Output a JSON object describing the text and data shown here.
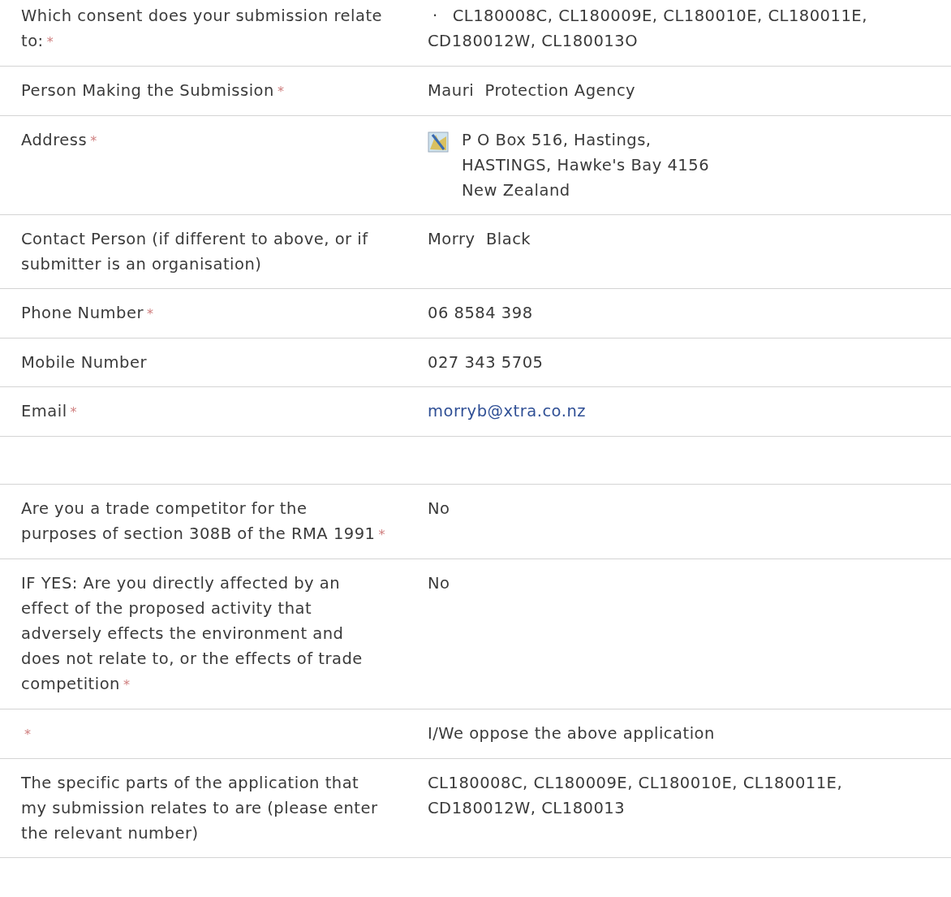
{
  "rows": [
    {
      "kind": "bullet",
      "label": "Which consent does your submission relate to:",
      "required_mark": "*",
      "bullet": "·",
      "value": "CL180008C, CL180009E, CL180010E, CL180011E, CD180012W, CL180013O"
    },
    {
      "kind": "text",
      "label": "Person Making the Submission",
      "required_mark": "*",
      "value": "Mauri  Protection Agency"
    },
    {
      "kind": "address",
      "label": "Address",
      "required_mark": "*",
      "lines": [
        "P O Box 516, Hastings,",
        "HASTINGS, Hawke's Bay 4156",
        "New Zealand"
      ]
    },
    {
      "kind": "text",
      "label": "Contact Person (if different to above, or if submitter is an organisation)",
      "value": "Morry  Black"
    },
    {
      "kind": "text",
      "label": "Phone Number",
      "required_mark": "*",
      "value": "06 8584 398"
    },
    {
      "kind": "text",
      "label": "Mobile Number",
      "value": "027 343 5705"
    },
    {
      "kind": "link",
      "label": "Email",
      "required_mark": "*",
      "value": "morryb@xtra.co.nz"
    },
    {
      "kind": "blank"
    },
    {
      "kind": "text",
      "label": "Are you a trade competitor for the purposes of section 308B of the RMA 1991",
      "required_mark": "*",
      "value": "No"
    },
    {
      "kind": "text",
      "label": "IF YES: Are you directly affected by an effect of the proposed activity that adversely effects the environment and does not relate to, or the effects of trade competition",
      "required_mark": "*",
      "value": "No"
    },
    {
      "kind": "text",
      "required_mark": "*",
      "value": "I/We oppose the above application"
    },
    {
      "kind": "text",
      "label": "The specific parts of the application that my submission relates to are (please enter the relevant number)",
      "value": "CL180008C, CL180009E, CL180010E, CL180011E, CD180012W, CL180013"
    }
  ]
}
